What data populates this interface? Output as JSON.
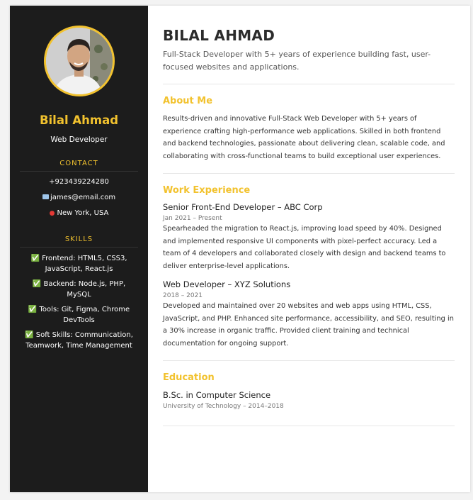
{
  "sidebar": {
    "name": "Bilal Ahmad",
    "title": "Web Developer",
    "contact_heading": "CONTACT",
    "phone": "+923439224280",
    "email_icon": "envelope-icon",
    "email": "james@email.com",
    "location_icon": "pin-icon",
    "location": "New York, USA",
    "skills_heading": "SKILLS",
    "skills": [
      "Frontend: HTML5, CSS3, JavaScript, React.js",
      "Backend: Node.js, PHP, MySQL",
      "Tools: Git, Figma, Chrome DevTools",
      "Soft Skills: Communication, Teamwork, Time Management"
    ]
  },
  "main": {
    "name": "BILAL AHMAD",
    "tagline": "Full-Stack Developer with 5+ years of experience building fast, user-focused websites and applications.",
    "about_heading": "About Me",
    "about_text": "Results-driven and innovative Full-Stack Web Developer with 5+ years of experience crafting high-performance web applications. Skilled in both frontend and backend technologies, passionate about delivering clean, scalable code, and collaborating with cross-functional teams to build exceptional user experiences.",
    "work_heading": "Work Experience",
    "jobs": [
      {
        "title": "Senior Front-End Developer – ABC Corp",
        "dates": "Jan 2021 – Present",
        "desc": "Spearheaded the migration to React.js, improving load speed by 40%. Designed and implemented responsive UI components with pixel-perfect accuracy. Led a team of 4 developers and collaborated closely with design and backend teams to deliver enterprise-level applications."
      },
      {
        "title": "Web Developer – XYZ Solutions",
        "dates": "2018 – 2021",
        "desc": "Developed and maintained over 20 websites and web apps using HTML, CSS, JavaScript, and PHP. Enhanced site performance, accessibility, and SEO, resulting in a 30% increase in organic traffic. Provided client training and technical documentation for ongoing support."
      }
    ],
    "education_heading": "Education",
    "degree": "B.Sc. in Computer Science",
    "school": "University of Technology – 2014–2018"
  },
  "colors": {
    "accent": "#f2c22e",
    "sidebar_bg": "#1c1c1c"
  }
}
